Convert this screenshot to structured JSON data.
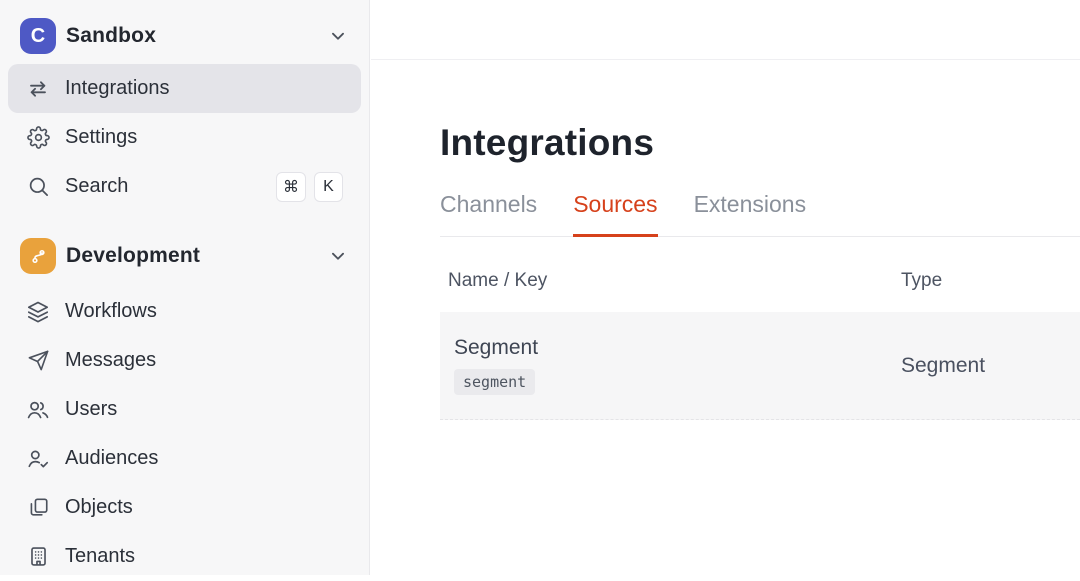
{
  "colors": {
    "accent": "#D6411B",
    "logo_bg": "#4E59C5",
    "dev_bg": "#E9A23C",
    "sidebar_bg": "#F7F7F8",
    "active_pill": "#E4E4E9"
  },
  "sidebar": {
    "workspace": {
      "logo_letter": "C",
      "label": "Sandbox"
    },
    "nav": [
      {
        "label": "Integrations"
      },
      {
        "label": "Settings"
      },
      {
        "label": "Search"
      }
    ],
    "shortcut": {
      "mod": "⌘",
      "key": "K"
    },
    "section": {
      "label": "Development"
    },
    "dev_items": [
      {
        "label": "Workflows"
      },
      {
        "label": "Messages"
      },
      {
        "label": "Users"
      },
      {
        "label": "Audiences"
      },
      {
        "label": "Objects"
      },
      {
        "label": "Tenants"
      }
    ]
  },
  "main": {
    "title": "Integrations",
    "tabs": [
      {
        "label": "Channels"
      },
      {
        "label": "Sources"
      },
      {
        "label": "Extensions"
      }
    ],
    "active_tab": "Sources",
    "table": {
      "columns": [
        "Name / Key",
        "Type"
      ],
      "row": {
        "name": "Segment",
        "key": "segment",
        "type": "Segment"
      }
    }
  }
}
